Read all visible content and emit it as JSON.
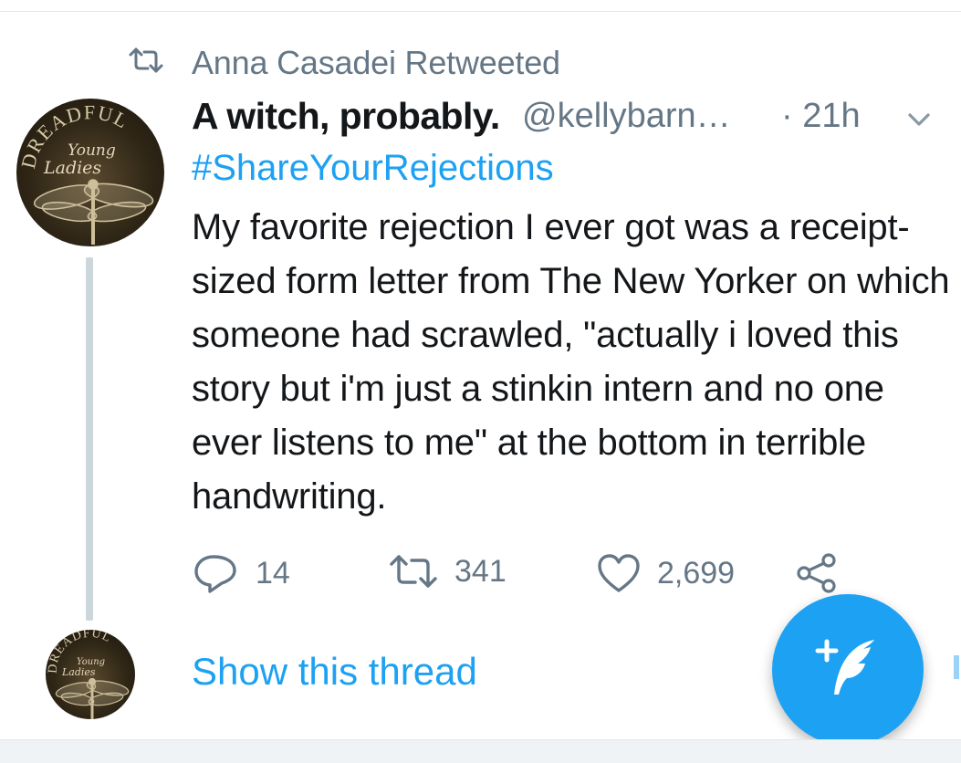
{
  "retweet_context": {
    "label": "Anna Casadei Retweeted",
    "icon": "retweet-icon"
  },
  "tweet": {
    "author_name": "A witch, probably.",
    "handle": "@kellybarn…",
    "time": "· 21h",
    "avatar_text": {
      "line1": "DREADFUL",
      "line2": "Young",
      "line3": "Ladies"
    },
    "hashtag": "#ShareYourRejections",
    "text": "My favorite rejection I ever got was a receipt-sized form letter from The New Yorker on which someone had scrawled, \"actually i loved this story but i'm just a stinkin intern and no one ever listens to me\" at the bottom in terrible handwriting.",
    "actions": {
      "replies": "14",
      "retweets": "341",
      "likes": "2,699"
    }
  },
  "thread": {
    "show_label": "Show this thread"
  },
  "colors": {
    "accent": "#1da1f2",
    "muted": "#657786",
    "text": "#14171a",
    "thread_line": "#ccd6dd"
  },
  "icons": [
    "retweet-icon",
    "chevron-down-icon",
    "reply-icon",
    "like-icon",
    "share-icon",
    "compose-tweet-icon"
  ]
}
